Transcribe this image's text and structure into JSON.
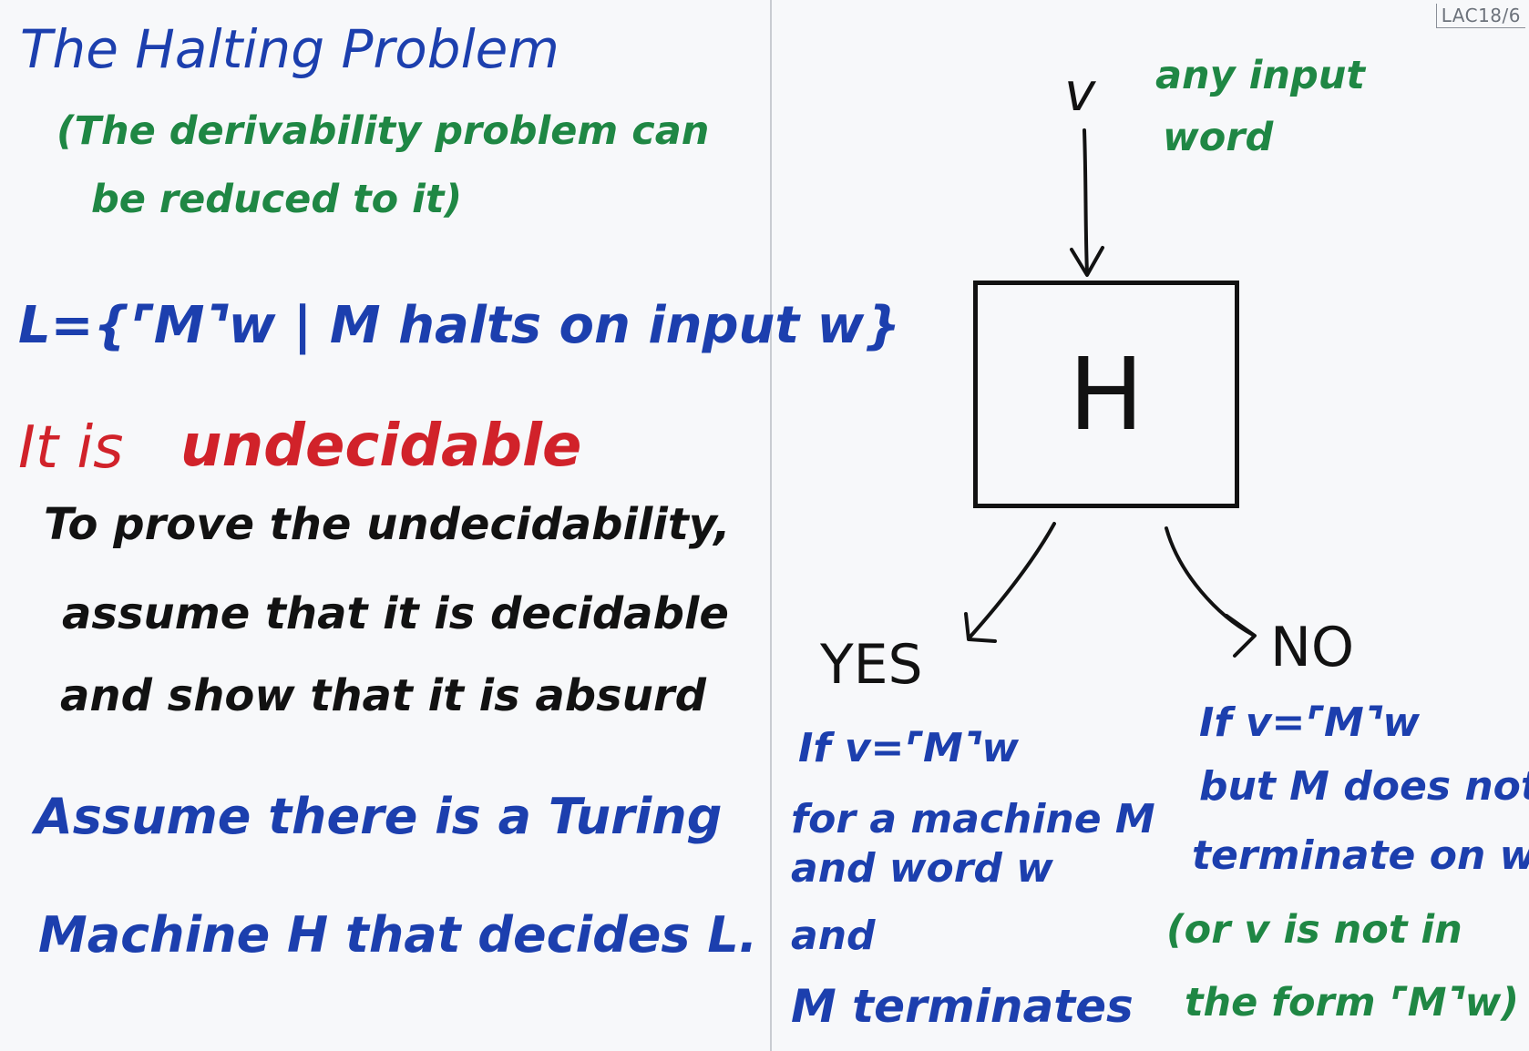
{
  "corner_tag": "LAC18/6",
  "left_panel": {
    "title": "The Halting Problem",
    "note_line1": "(The derivability problem can",
    "note_line2": "be reduced to it)",
    "language_def": "L={⌜M⌝w | M halts on input w}",
    "undecidable_prefix": "It is",
    "undecidable_word": "undecidable",
    "proof_line1": "To prove the undecidability,",
    "proof_line2": "assume that it is decidable",
    "proof_line3": "and show that it is absurd",
    "assume_line1": "Assume there is a Turing",
    "assume_line2": "Machine H that decides L."
  },
  "right_panel": {
    "input_symbol": "v",
    "input_note_line1": "any input",
    "input_note_line2": "word",
    "machine_label": "H",
    "yes_label": "YES",
    "no_label": "NO",
    "yes_lines": [
      "If v=⌜M⌝w",
      "for a machine M",
      "and word w",
      "and",
      "M terminates"
    ],
    "no_lines": [
      "If v=⌜M⌝w",
      "but M does not",
      "terminate on w",
      "(or v is not in",
      "the form ⌜M⌝w)"
    ]
  },
  "colors": {
    "blue": "#1c3fae",
    "green": "#1f8744",
    "red": "#d1222a",
    "black": "#121212"
  }
}
